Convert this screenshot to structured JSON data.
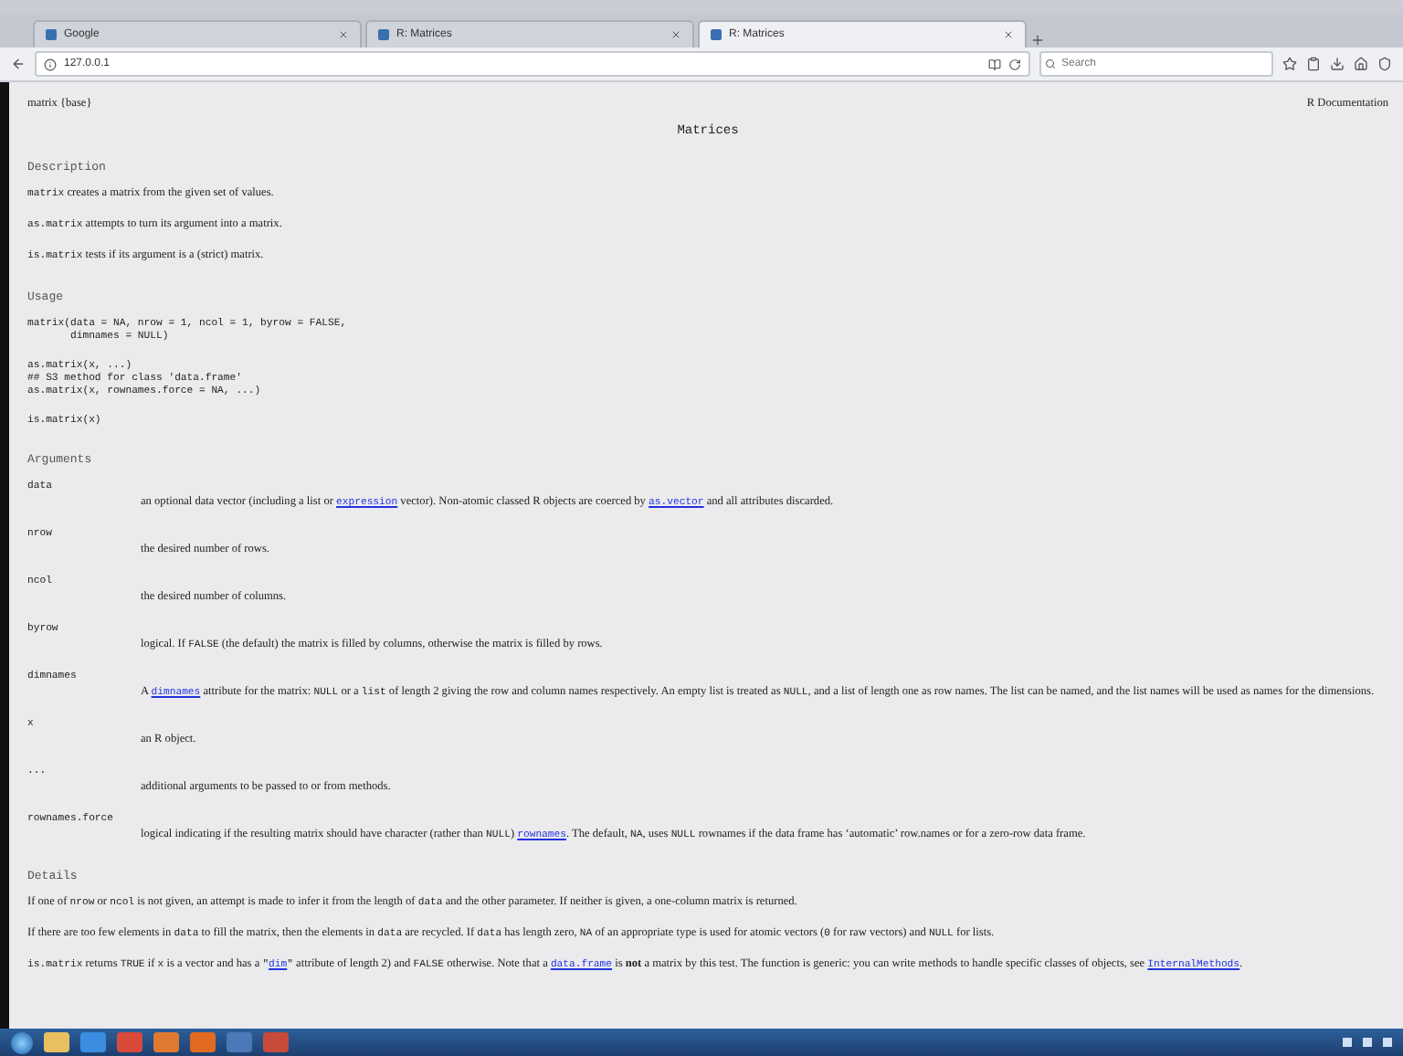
{
  "browser": {
    "tabs": [
      {
        "title": "Google",
        "selected": false
      },
      {
        "title": "R: Matrices",
        "selected": false
      },
      {
        "title": "R: Matrices",
        "selected": true
      }
    ],
    "address": "127.0.0.1",
    "search": {
      "placeholder": "Search"
    }
  },
  "page": {
    "header_left": "matrix {base}",
    "header_right": "R Documentation",
    "title": "Matrices",
    "sections": [
      {
        "heading": "Description",
        "blocks": [
          {
            "kind": "para",
            "segments": [
              {
                "kind": "code",
                "text": "matrix"
              },
              {
                "kind": "text",
                "text": " creates a matrix from the given set of values."
              }
            ]
          },
          {
            "kind": "para",
            "segments": [
              {
                "kind": "code",
                "text": "as.matrix"
              },
              {
                "kind": "text",
                "text": " attempts to turn its argument into a matrix."
              }
            ]
          },
          {
            "kind": "para",
            "segments": [
              {
                "kind": "code",
                "text": "is.matrix"
              },
              {
                "kind": "text",
                "text": " tests if its argument is a (strict) matrix."
              }
            ]
          }
        ]
      },
      {
        "heading": "Usage",
        "blocks": [
          {
            "kind": "code",
            "text": "matrix(data = NA, nrow = 1, ncol = 1, byrow = FALSE,\n       dimnames = NULL)"
          },
          {
            "kind": "code",
            "text": "as.matrix(x, ...)\n## S3 method for class 'data.frame'\nas.matrix(x, rownames.force = NA, ...)"
          },
          {
            "kind": "code",
            "text": "is.matrix(x)"
          }
        ]
      },
      {
        "heading": "Arguments",
        "blocks": [
          {
            "kind": "argument",
            "name": "data",
            "segments": [
              {
                "kind": "text",
                "text": "an optional data vector (including a list or "
              },
              {
                "kind": "link",
                "text": "expression"
              },
              {
                "kind": "text",
                "text": " vector). Non-atomic classed R objects are coerced by "
              },
              {
                "kind": "link",
                "text": "as.vector"
              },
              {
                "kind": "text",
                "text": " and all attributes discarded."
              }
            ]
          },
          {
            "kind": "argument",
            "name": "nrow",
            "segments": [
              {
                "kind": "text",
                "text": "the desired number of rows."
              }
            ]
          },
          {
            "kind": "argument",
            "name": "ncol",
            "segments": [
              {
                "kind": "text",
                "text": "the desired number of columns."
              }
            ]
          },
          {
            "kind": "argument",
            "name": "byrow",
            "segments": [
              {
                "kind": "text",
                "text": "logical. If "
              },
              {
                "kind": "code",
                "text": "FALSE"
              },
              {
                "kind": "text",
                "text": " (the default) the matrix is filled by columns, otherwise the matrix is filled by rows."
              }
            ]
          },
          {
            "kind": "argument",
            "name": "dimnames",
            "segments": [
              {
                "kind": "text",
                "text": "A "
              },
              {
                "kind": "link",
                "text": "dimnames"
              },
              {
                "kind": "text",
                "text": " attribute for the matrix: "
              },
              {
                "kind": "code",
                "text": "NULL"
              },
              {
                "kind": "text",
                "text": " or a "
              },
              {
                "kind": "code",
                "text": "list"
              },
              {
                "kind": "text",
                "text": " of length 2 giving the row and column names respectively. An empty list is treated as "
              },
              {
                "kind": "code",
                "text": "NULL"
              },
              {
                "kind": "text",
                "text": ", and a list of length one as row names. The list can be named, and the list names will be used as names for the dimensions."
              }
            ]
          },
          {
            "kind": "argument",
            "name": "x",
            "segments": [
              {
                "kind": "text",
                "text": "an R object."
              }
            ]
          },
          {
            "kind": "argument",
            "name": "...",
            "segments": [
              {
                "kind": "text",
                "text": "additional arguments to be passed to or from methods."
              }
            ]
          },
          {
            "kind": "argument",
            "name": "rownames.force",
            "segments": [
              {
                "kind": "text",
                "text": "logical indicating if the resulting matrix should have character (rather than "
              },
              {
                "kind": "code",
                "text": "NULL"
              },
              {
                "kind": "text",
                "text": ") "
              },
              {
                "kind": "link",
                "text": "rownames"
              },
              {
                "kind": "text",
                "text": ". The default, "
              },
              {
                "kind": "code",
                "text": "NA"
              },
              {
                "kind": "text",
                "text": ", uses "
              },
              {
                "kind": "code",
                "text": "NULL"
              },
              {
                "kind": "text",
                "text": " rownames if the data frame has ‘automatic’ row.names or for a zero-row data frame."
              }
            ]
          }
        ]
      },
      {
        "heading": "Details",
        "blocks": [
          {
            "kind": "para",
            "segments": [
              {
                "kind": "text",
                "text": "If one of "
              },
              {
                "kind": "code",
                "text": "nrow"
              },
              {
                "kind": "text",
                "text": " or "
              },
              {
                "kind": "code",
                "text": "ncol"
              },
              {
                "kind": "text",
                "text": " is not given, an attempt is made to infer it from the length of "
              },
              {
                "kind": "code",
                "text": "data"
              },
              {
                "kind": "text",
                "text": " and the other parameter. If neither is given, a one-column matrix is returned."
              }
            ]
          },
          {
            "kind": "para",
            "segments": [
              {
                "kind": "text",
                "text": "If there are too few elements in "
              },
              {
                "kind": "code",
                "text": "data"
              },
              {
                "kind": "text",
                "text": " to fill the matrix, then the elements in "
              },
              {
                "kind": "code",
                "text": "data"
              },
              {
                "kind": "text",
                "text": " are recycled. If "
              },
              {
                "kind": "code",
                "text": "data"
              },
              {
                "kind": "text",
                "text": " has length zero, "
              },
              {
                "kind": "code",
                "text": "NA"
              },
              {
                "kind": "text",
                "text": " of an appropriate type is used for atomic vectors ("
              },
              {
                "kind": "code",
                "text": "0"
              },
              {
                "kind": "text",
                "text": " for raw vectors) and "
              },
              {
                "kind": "code",
                "text": "NULL"
              },
              {
                "kind": "text",
                "text": " for lists."
              }
            ]
          },
          {
            "kind": "para",
            "segments": [
              {
                "kind": "code",
                "text": "is.matrix"
              },
              {
                "kind": "text",
                "text": " returns "
              },
              {
                "kind": "code",
                "text": "TRUE"
              },
              {
                "kind": "text",
                "text": " if "
              },
              {
                "kind": "code",
                "text": "x"
              },
              {
                "kind": "text",
                "text": " is a vector and has a "
              },
              {
                "kind": "code",
                "text": "\""
              },
              {
                "kind": "link",
                "text": "dim"
              },
              {
                "kind": "code",
                "text": "\""
              },
              {
                "kind": "text",
                "text": " attribute of length 2) and "
              },
              {
                "kind": "code",
                "text": "FALSE"
              },
              {
                "kind": "text",
                "text": " otherwise. Note that a "
              },
              {
                "kind": "link",
                "text": "data.frame"
              },
              {
                "kind": "text",
                "text": " is **not** a matrix by this test. The function is generic: you can write methods to handle specific classes of objects, see "
              },
              {
                "kind": "link",
                "text": "InternalMethods"
              },
              {
                "kind": "text",
                "text": "."
              }
            ]
          }
        ]
      }
    ]
  }
}
